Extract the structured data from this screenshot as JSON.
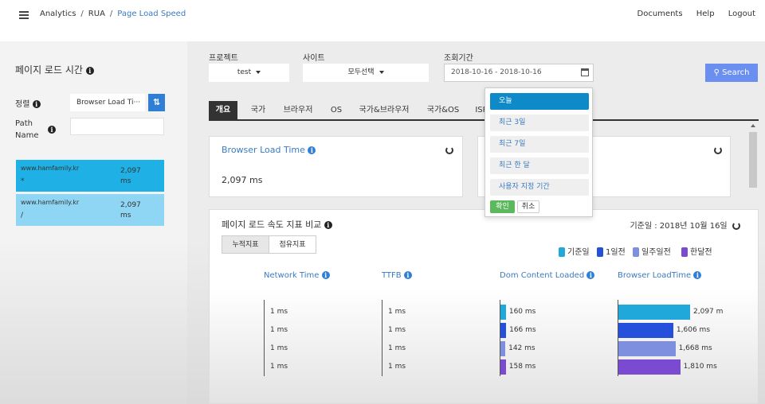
{
  "header": {
    "breadcrumbs": [
      "Analytics",
      "RUA",
      "Page Load Speed"
    ],
    "links": [
      "Documents",
      "Help",
      "Logout"
    ]
  },
  "sidebar": {
    "title": "페이지 로드 시간",
    "sort_label": "정렬",
    "sort_value": "Browser Load Ti···",
    "path_label_1": "Path",
    "path_label_2": "Name",
    "path_value": "",
    "items": [
      {
        "domain": "www.hamfamily.kr",
        "path": "*",
        "value": "2,097",
        "unit": "ms"
      },
      {
        "domain": "www.hamfamily.kr",
        "path": "/",
        "value": "2,097",
        "unit": "ms"
      }
    ]
  },
  "filters": {
    "project_label": "프로젝트",
    "project_value": "test",
    "site_label": "사이트",
    "site_value": "모두선택",
    "period_label": "조회기간",
    "period_value": "2018-10-16 - 2018-10-16",
    "search_label": "Search"
  },
  "tabs": [
    "개요",
    "국가",
    "브라우저",
    "OS",
    "국가&브라우저",
    "국가&OS",
    "ISP"
  ],
  "cards": [
    {
      "title": "Browser Load Time",
      "value": "2,097 ms"
    },
    {
      "title": "",
      "value": ""
    }
  ],
  "compare": {
    "title": "페이지 로드 속도 지표 비교",
    "date_label": "기준일 : 2018년 10월 16일",
    "subtabs": [
      "누적지표",
      "점유지표"
    ],
    "legend": [
      {
        "label": "기준일",
        "color": "#1fa8d9"
      },
      {
        "label": "1일전",
        "color": "#2450dc"
      },
      {
        "label": "일주일전",
        "color": "#7e8fe0"
      },
      {
        "label": "한달전",
        "color": "#7a4bd1"
      }
    ]
  },
  "chart_data": {
    "type": "bar",
    "orientation": "horizontal",
    "unit": "ms",
    "series_names": [
      "기준일",
      "1일전",
      "일주일전",
      "한달전"
    ],
    "colors": [
      "#1fa8d9",
      "#2450dc",
      "#7e8fe0",
      "#7a4bd1"
    ],
    "metrics": [
      {
        "name": "Network Time",
        "values": [
          1,
          1,
          1,
          1
        ],
        "labels": [
          "1 ms",
          "1 ms",
          "1 ms",
          "1 ms"
        ]
      },
      {
        "name": "TTFB",
        "values": [
          1,
          1,
          1,
          1
        ],
        "labels": [
          "1 ms",
          "1 ms",
          "1 ms",
          "1 ms"
        ]
      },
      {
        "name": "Dom Content Loaded",
        "values": [
          160,
          166,
          142,
          158
        ],
        "labels": [
          "160 ms",
          "166 ms",
          "142 ms",
          "158 ms"
        ]
      },
      {
        "name": "Browser LoadTime",
        "values": [
          2097,
          1606,
          1668,
          1810
        ],
        "labels": [
          "2,097 m",
          "1,606 ms",
          "1,668 ms",
          "1,810 ms"
        ]
      }
    ]
  },
  "date_dropdown": {
    "options": [
      "오늘",
      "최근 3일",
      "최근 7일",
      "최근 한 달",
      "사용자 지정 기간"
    ],
    "selected": "오늘",
    "ok_label": "확인",
    "cancel_label": "취소"
  }
}
